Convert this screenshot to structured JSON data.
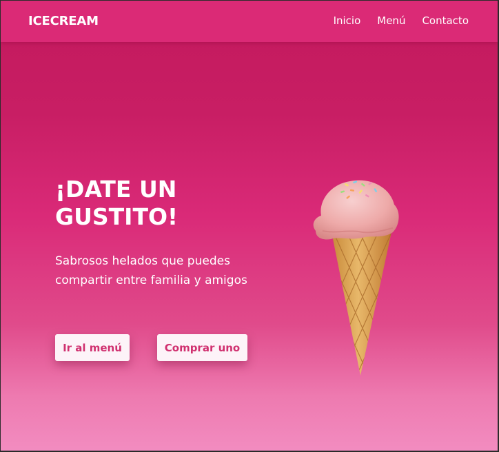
{
  "navbar": {
    "brand": "ICECREAM",
    "links": [
      "Inicio",
      "Menú",
      "Contacto"
    ]
  },
  "hero": {
    "title": "¡DATE UN GUSTITO!",
    "subtitle": "Sabrosos helados que puedes compartir entre familia y amigos",
    "buttons": {
      "menu_label": "Ir al menú",
      "buy_label": "Comprar uno"
    },
    "image": "ice-cream-cone"
  },
  "colors": {
    "navbar": "#db2a76",
    "background_top": "#c3195d",
    "background_bottom": "#f28cc0",
    "button_bg": "#fdf3f8",
    "button_text": "#d0306f",
    "text": "#ffffff"
  }
}
